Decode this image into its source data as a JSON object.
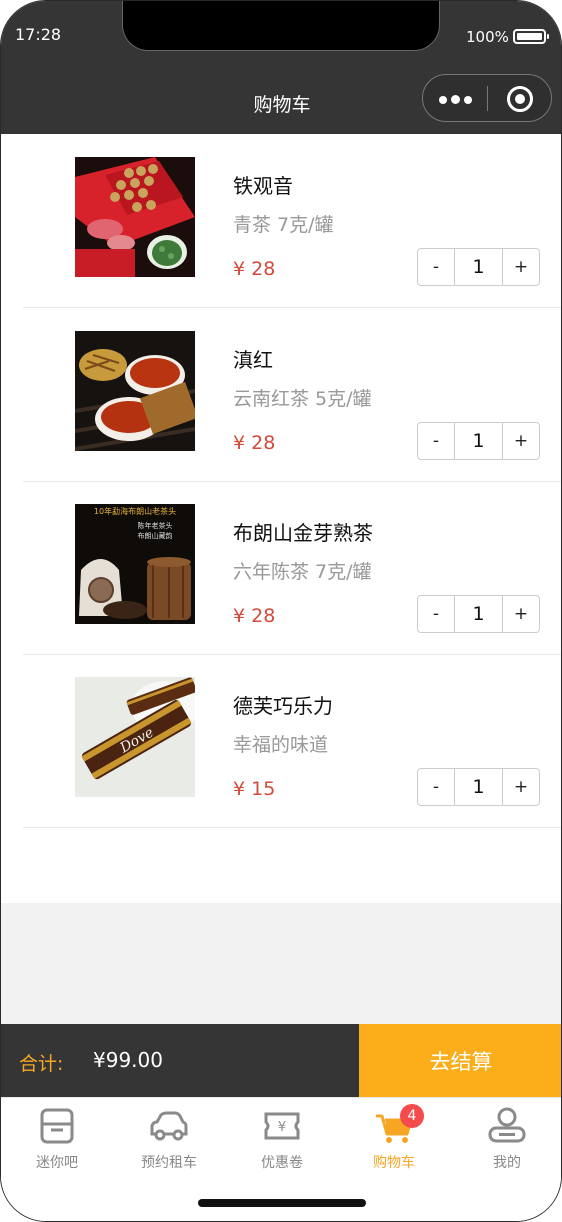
{
  "status": {
    "time": "17:28",
    "battery": "100%"
  },
  "nav": {
    "title": "购物车"
  },
  "items": [
    {
      "name": "铁观音",
      "spec": "青茶 7克/罐",
      "price": "¥ 28",
      "qty": "1",
      "minus": "-",
      "plus": "+"
    },
    {
      "name": "滇红",
      "spec": "云南红茶 5克/罐",
      "price": "¥ 28",
      "qty": "1",
      "minus": "-",
      "plus": "+"
    },
    {
      "name": "布朗山金芽熟茶",
      "spec": "六年陈茶 7克/罐",
      "price": "¥ 28",
      "qty": "1",
      "minus": "-",
      "plus": "+",
      "image_text": [
        "10年勐海布朗山老茶头",
        "陈年老茶头",
        "布朗山藏韵"
      ]
    },
    {
      "name": "德芙巧乐力",
      "spec": "幸福的味道",
      "price": "¥ 15",
      "qty": "1",
      "minus": "-",
      "plus": "+",
      "image_text": [
        "Dove"
      ]
    }
  ],
  "checkout": {
    "total_label": "合计:",
    "total_amount": "¥99.00",
    "button": "去结算"
  },
  "tabbar": {
    "tabs": [
      {
        "label": "迷你吧",
        "icon": "minibar-icon"
      },
      {
        "label": "预约租车",
        "icon": "car-icon"
      },
      {
        "label": "优惠卷",
        "icon": "coupon-icon"
      },
      {
        "label": "购物车",
        "icon": "cart-icon",
        "active": true,
        "badge": "4"
      },
      {
        "label": "我的",
        "icon": "user-icon"
      }
    ]
  },
  "colors": {
    "accent": "#fbad1a",
    "price": "#d24a3a",
    "dark": "#353535",
    "badge": "#f44b4b"
  }
}
